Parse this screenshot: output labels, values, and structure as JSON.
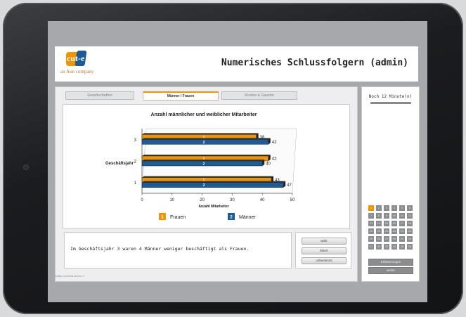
{
  "app": {
    "logo_text": "cut-e",
    "logo_subtitle": "an Aon company",
    "title": "Numerisches Schlussfolgern (admin)"
  },
  "tabs": [
    {
      "label": "Gesellschaften",
      "active": false
    },
    {
      "label": "Männer / Frauen",
      "active": true
    },
    {
      "label": "Kosten & Gewinn",
      "active": false
    }
  ],
  "chart_data": {
    "type": "bar",
    "orientation": "horizontal",
    "title": "Anzahl männlicher und weiblicher Mitarbeiter",
    "ylabel": "Geschäftsjahr",
    "xlabel": "Anzahl Mitarbeiter",
    "categories": [
      "1",
      "2",
      "3"
    ],
    "series": [
      {
        "name": "Frauen",
        "legend_marker": "1",
        "bar_label": "1",
        "color": "#f29400",
        "values": [
          43,
          42,
          38
        ]
      },
      {
        "name": "Männer",
        "legend_marker": "2",
        "bar_label": "2",
        "color": "#1c5b96",
        "values": [
          47,
          40,
          42
        ]
      }
    ],
    "xlim": [
      0,
      50
    ],
    "xticks": [
      "0",
      "10",
      "20",
      "30",
      "40",
      "50"
    ],
    "legend_position": "bottom",
    "grid": false
  },
  "statement": "Im Geschäftsjahr 3 waren 4 Männer weniger beschäftigt als Frauen.",
  "answers": {
    "true_label": "wahr",
    "false_label": "falsch",
    "undecided_label": "unbestimmt"
  },
  "footer_note": "testlay numerical admin 1.1",
  "sidebar": {
    "timer_text": "Noch 12 Minute(n)",
    "questions": [
      "1",
      "2",
      "3",
      "4",
      "5",
      "6",
      "7",
      "8",
      "9",
      "10",
      "11",
      "12",
      "13",
      "14",
      "15",
      "16",
      "17",
      "18",
      "19",
      "20",
      "21",
      "22",
      "23",
      "24",
      "25",
      "26",
      "27",
      "28",
      "29",
      "30",
      "31",
      "32",
      "33",
      "34",
      "35",
      "36"
    ],
    "current_question": "1",
    "help_label": "Erläuterungen",
    "next_label": "weiter"
  },
  "colors": {
    "accent": "#f29400",
    "brand_blue": "#1c5b96"
  }
}
